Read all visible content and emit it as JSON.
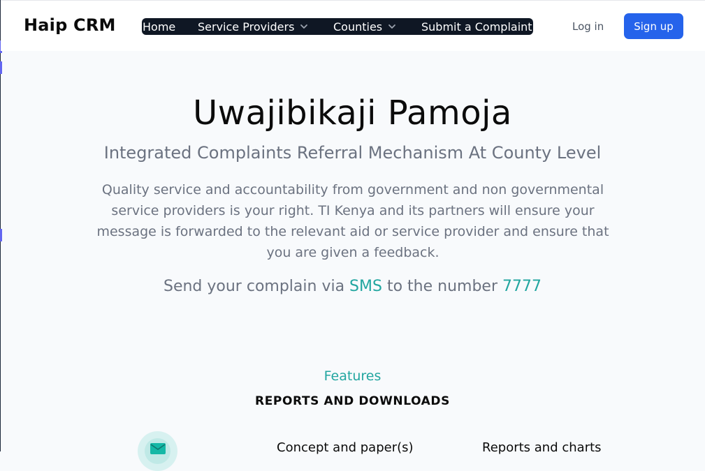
{
  "header": {
    "brand": "Haip CRM",
    "nav": [
      {
        "label": "Home",
        "has_dropdown": false
      },
      {
        "label": "Service Providers",
        "has_dropdown": true
      },
      {
        "label": "Counties",
        "has_dropdown": true
      },
      {
        "label": "Submit a Complaint",
        "has_dropdown": false
      }
    ],
    "login_label": "Log in",
    "signup_label": "Sign up"
  },
  "hero": {
    "title": "Uwajibikaji Pamoja",
    "subtitle": "Integrated Complaints Referral Mechanism At County Level",
    "description": "Quality service and accountability from government and non governmental service providers is your right. TI Kenya and its partners will ensure your message is forwarded to the relevant aid or service provider and ensure that you are given a feedback.",
    "sms": {
      "prefix": "Send your complain via ",
      "channel": "SMS",
      "middle": " to the number ",
      "number": "7777"
    }
  },
  "features": {
    "kicker": "Features",
    "heading": "REPORTS AND DOWNLOADS",
    "items": [
      {
        "icon": "mail-icon",
        "title": ""
      },
      {
        "title": "Concept and paper(s)"
      },
      {
        "title": "Reports and charts"
      }
    ]
  },
  "colors": {
    "accent": "#22a6a0",
    "primary": "#2563eb",
    "nav_bg": "#0f1724",
    "page_bg": "#f8fafc"
  }
}
